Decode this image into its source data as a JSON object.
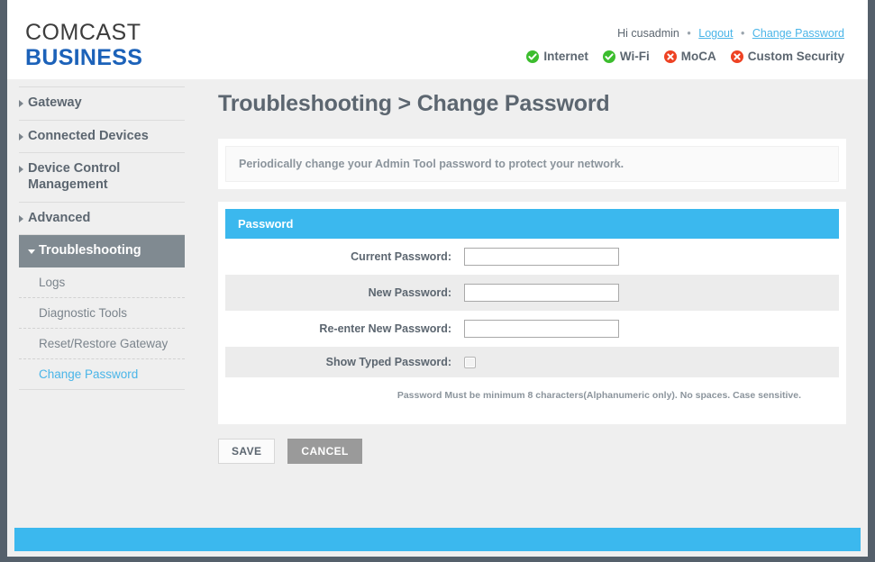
{
  "brand": {
    "logo_top": "COMCAST",
    "logo_bottom": "BUSINESS"
  },
  "header": {
    "greeting": "Hi cusadmin",
    "separator": "•",
    "logout_label": "Logout",
    "change_password_label": "Change Password",
    "status": [
      {
        "label": "Internet",
        "state": "ok",
        "icon": "check-circle-icon"
      },
      {
        "label": "Wi-Fi",
        "state": "ok",
        "icon": "check-circle-icon"
      },
      {
        "label": "MoCA",
        "state": "error",
        "icon": "x-circle-icon"
      },
      {
        "label": "Custom Security",
        "state": "error",
        "icon": "x-circle-icon"
      }
    ],
    "colors": {
      "ok": "#3cbd2e",
      "error": "#ee4223",
      "link": "#4ab5e8"
    }
  },
  "sidebar": {
    "items": [
      {
        "label": "Gateway",
        "active": false
      },
      {
        "label": "Connected Devices",
        "active": false
      },
      {
        "label": "Device Control Management",
        "active": false
      },
      {
        "label": "Advanced",
        "active": false
      },
      {
        "label": "Troubleshooting",
        "active": true
      }
    ],
    "sub_items": [
      {
        "label": "Logs",
        "current": false
      },
      {
        "label": "Diagnostic Tools",
        "current": false
      },
      {
        "label": "Reset/Restore Gateway",
        "current": false
      },
      {
        "label": "Change Password",
        "current": true
      }
    ]
  },
  "main": {
    "title": "Troubleshooting > Change Password",
    "banner": "Periodically change your Admin Tool password to protect your network.",
    "panel_title": "Password",
    "panel_accent": "#3bb8ee",
    "fields": [
      {
        "label": "Current Password:",
        "value": "",
        "type": "password"
      },
      {
        "label": "New Password:",
        "value": "",
        "type": "password"
      },
      {
        "label": "Re-enter New Password:",
        "value": "",
        "type": "password"
      }
    ],
    "show_password": {
      "label": "Show Typed Password:",
      "checked": false
    },
    "hint": "Password Must be minimum 8 characters(Alphanumeric only). No spaces. Case sensitive.",
    "save_label": "SAVE",
    "cancel_label": "CANCEL"
  }
}
